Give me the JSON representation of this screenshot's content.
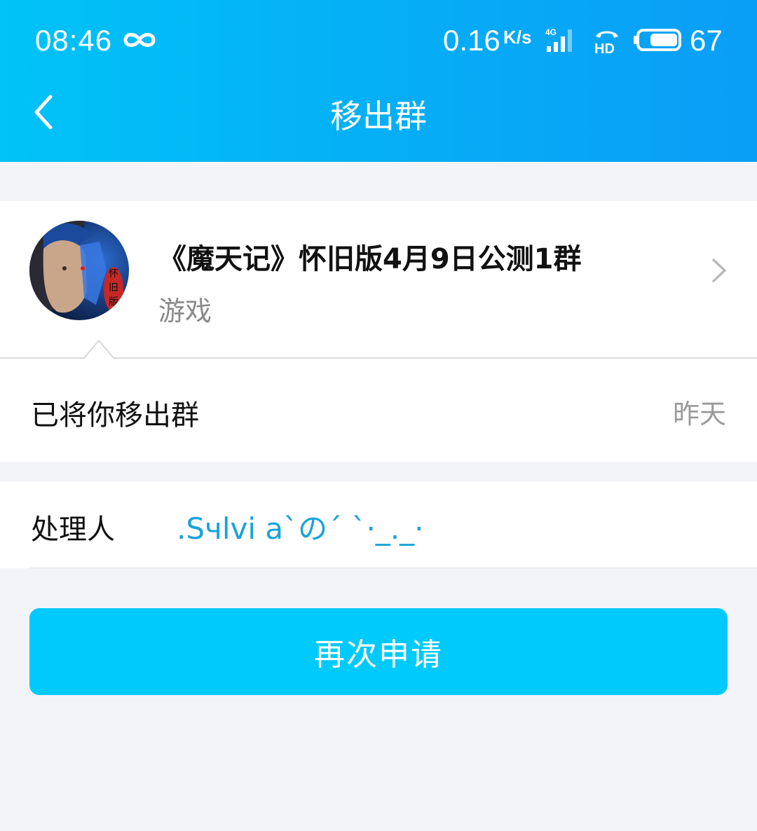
{
  "status_bar": {
    "time": "08:46",
    "net_speed": "0.16",
    "net_unit": "K/s",
    "network_type": "4G",
    "hd_label": "HD",
    "battery_level": "67",
    "icons": [
      "infinity-icon",
      "signal-icon",
      "hd-call-icon",
      "battery-icon"
    ]
  },
  "header": {
    "title": "移出群",
    "back_icon": "chevron-left-icon"
  },
  "group": {
    "name": "《魔天记》怀旧版4月9日公测1群",
    "category": "游戏",
    "avatar_badge": "怀旧版",
    "chevron_icon": "chevron-right-icon"
  },
  "notice": {
    "text": "已将你移出群",
    "time": "昨天"
  },
  "handler": {
    "label": "处理人",
    "name": ".Sчlvi a`の´ `·_._·"
  },
  "actions": {
    "reapply_label": "再次申请"
  },
  "colors": {
    "header_start": "#00c3f7",
    "header_end": "#0a9ef7",
    "button": "#00cafc",
    "link": "#1aa3d9",
    "background": "#f3f4f8"
  }
}
